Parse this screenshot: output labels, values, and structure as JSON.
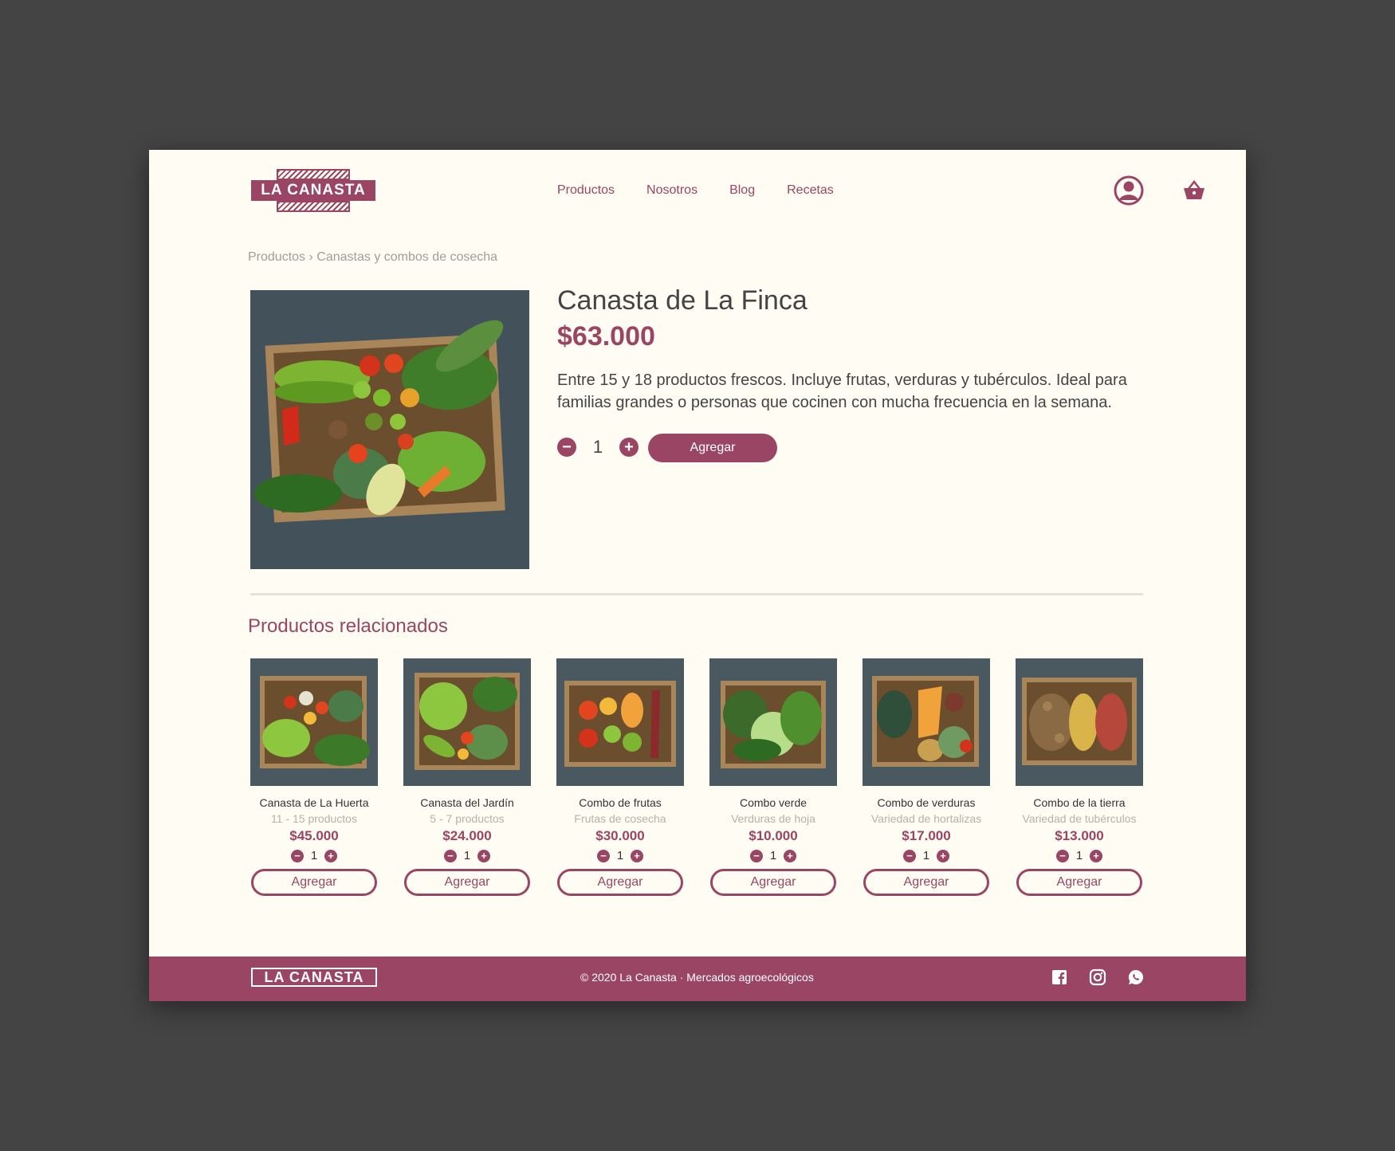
{
  "brand": {
    "name": "LA CANASTA"
  },
  "nav": {
    "items": [
      "Productos",
      "Nosotros",
      "Blog",
      "Recetas"
    ]
  },
  "icons": {
    "user": "user-circle-icon",
    "cart": "basket-icon"
  },
  "breadcrumb": {
    "root": "Productos",
    "separator": "›",
    "current": "Canastas y combos de cosecha"
  },
  "product": {
    "title": "Canasta de La Finca",
    "price": "$63.000",
    "description": "Entre 15 y 18 productos frescos. Incluye frutas, verduras y tubérculos. Ideal para familias grandes o personas que cocinen con mucha frecuencia en la semana.",
    "quantity": "1",
    "add_label": "Agregar"
  },
  "related": {
    "title": "Productos relacionados",
    "items": [
      {
        "name": "Canasta de La Huerta",
        "subtitle": "11 - 15 productos",
        "price": "$45.000",
        "quantity": "1",
        "add_label": "Agregar"
      },
      {
        "name": "Canasta del Jardín",
        "subtitle": "5 - 7 productos",
        "price": "$24.000",
        "quantity": "1",
        "add_label": "Agregar"
      },
      {
        "name": "Combo de frutas",
        "subtitle": "Frutas de cosecha",
        "price": "$30.000",
        "quantity": "1",
        "add_label": "Agregar"
      },
      {
        "name": "Combo verde",
        "subtitle": "Verduras de hoja",
        "price": "$10.000",
        "quantity": "1",
        "add_label": "Agregar"
      },
      {
        "name": "Combo de verduras",
        "subtitle": "Variedad de hortalizas",
        "price": "$17.000",
        "quantity": "1",
        "add_label": "Agregar"
      },
      {
        "name": "Combo de la tierra",
        "subtitle": "Variedad de tubérculos",
        "price": "$13.000",
        "quantity": "1",
        "add_label": "Agregar"
      }
    ]
  },
  "footer": {
    "brand": "LA CANASTA",
    "copyright": "© 2020 La Canasta · Mercados agroecológicos",
    "social": [
      "facebook-icon",
      "instagram-icon",
      "whatsapp-icon"
    ]
  },
  "colors": {
    "accent": "#9A4564",
    "background": "#FFFCF4",
    "backdrop": "#444444",
    "text": "#444444"
  }
}
